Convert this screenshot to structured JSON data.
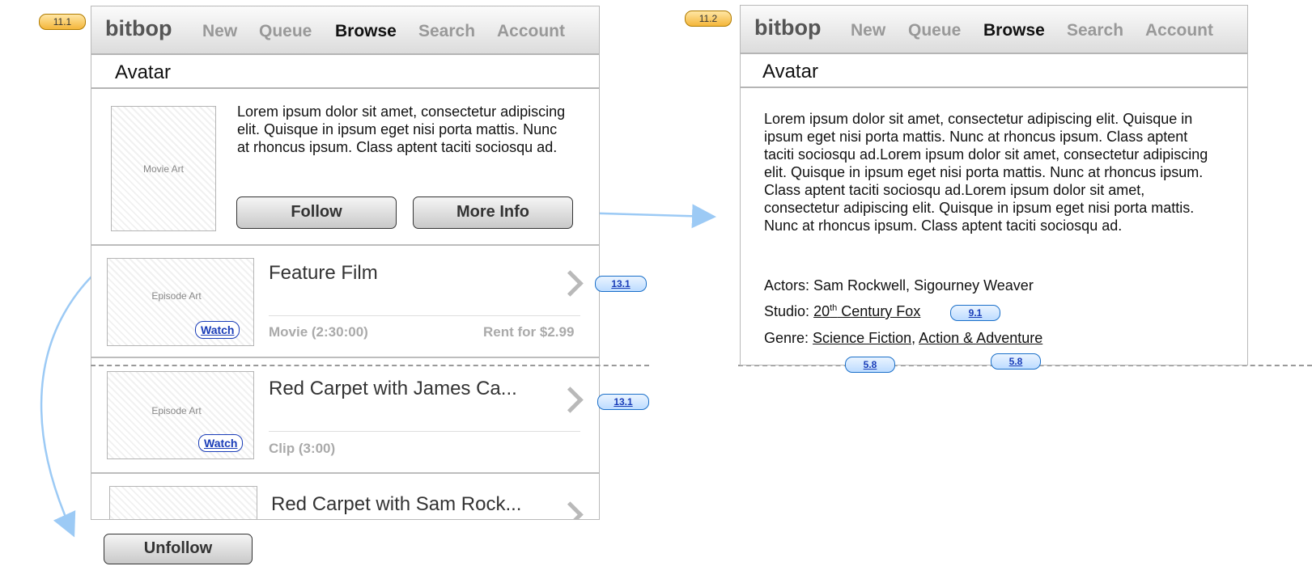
{
  "annotations": {
    "page_tag_left": "11.1",
    "page_tag_right": "11.2",
    "episode_link_1": "13.1",
    "episode_link_2": "13.1",
    "studio_link": "9.1",
    "genre_link_1": "5.8",
    "genre_link_2": "5.8"
  },
  "nav": {
    "brand": "bitbop",
    "items": [
      "New",
      "Queue",
      "Browse",
      "Search",
      "Account"
    ],
    "active": "Browse"
  },
  "left": {
    "title": "Avatar",
    "movie_art_label": "Movie Art",
    "description": "Lorem ipsum dolor sit amet, consectetur adipiscing elit. Quisque in ipsum eget nisi porta mattis. Nunc at rhoncus ipsum. Class aptent taciti sociosqu ad.",
    "follow_label": "Follow",
    "more_info_label": "More Info",
    "episodes": [
      {
        "art_label": "Episode Art",
        "watch_label": "Watch",
        "title": "Feature Film",
        "meta": "Movie (2:30:00)",
        "price": "Rent for $2.99"
      },
      {
        "art_label": "Episode Art",
        "watch_label": "Watch",
        "title": "Red Carpet with James Ca...",
        "meta": "Clip (3:00)",
        "price": ""
      },
      {
        "title": "Red Carpet with Sam Rock..."
      }
    ],
    "unfollow_label": "Unfollow"
  },
  "right": {
    "title": "Avatar",
    "description": "Lorem ipsum dolor sit amet, consectetur adipiscing elit. Quisque in ipsum eget nisi porta mattis. Nunc at rhoncus ipsum. Class aptent taciti sociosqu ad.Lorem ipsum dolor sit amet, consectetur adipiscing elit. Quisque in ipsum eget nisi porta mattis. Nunc at rhoncus ipsum. Class aptent taciti sociosqu ad.Lorem ipsum dolor sit amet, consectetur adipiscing elit. Quisque in ipsum eget nisi porta mattis. Nunc at rhoncus ipsum. Class aptent taciti sociosqu ad.",
    "actors_label": "Actors:",
    "actors": "Sam Rockwell, Sigourney Weaver",
    "studio_label": "Studio:",
    "studio_num": "20",
    "studio_sup": "th",
    "studio_rest": " Century Fox",
    "genre_label": "Genre:",
    "genre_1": "Science Fiction",
    "genre_sep": ",",
    "genre_2": "Action & Adventure"
  },
  "colors": {
    "arrow": "#9ccaf5",
    "tag_orange": "#f4b63a",
    "link_blue": "#1a3db8"
  }
}
